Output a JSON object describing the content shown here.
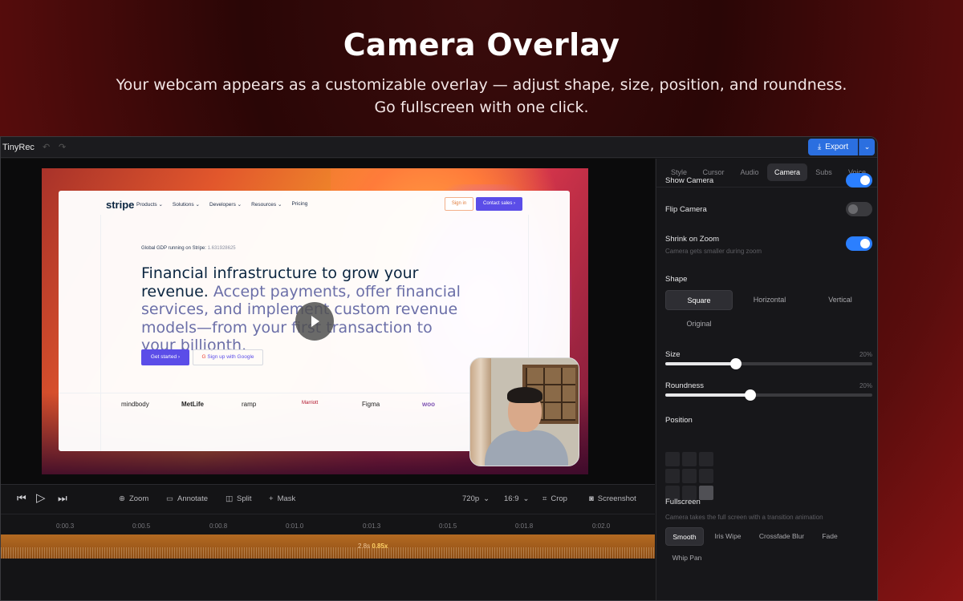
{
  "hero": {
    "title": "Camera Overlay",
    "subtitle_line1": "Your webcam appears as a customizable overlay — adjust shape, size, position, and roundness.",
    "subtitle_line2": "Go fullscreen with one click."
  },
  "app": {
    "name": "TinyRec",
    "export_label": "Export"
  },
  "website": {
    "logo": "stripe",
    "nav": [
      "Products",
      "Solutions",
      "Developers",
      "Resources",
      "Pricing"
    ],
    "signin": "Sign in",
    "contact": "Contact sales",
    "gdp_label": "Global GDP running on Stripe:",
    "gdp_value": "1.631928625",
    "headline_main": "Financial infrastructure to grow your revenue.",
    "headline_sub": "Accept payments, offer financial services, and implement custom revenue models—from your first transaction to your billionth.",
    "get_started": "Get started",
    "google_signup": "Sign up with Google",
    "logos": [
      "mindbody",
      "MetLife",
      "ramp",
      "Marriott",
      "Figma",
      "woo"
    ]
  },
  "toolbar": {
    "zoom": "Zoom",
    "annotate": "Annotate",
    "split": "Split",
    "mask": "Mask",
    "resolution": "720p",
    "aspect": "16:9",
    "crop": "Crop",
    "screenshot": "Screenshot"
  },
  "timeline": {
    "ticks": [
      "0:00.3",
      "0:00.5",
      "0:00.8",
      "0:01.0",
      "0:01.3",
      "0:01.5",
      "0:01.8",
      "0:02.0"
    ],
    "clip_duration": "2.8s",
    "clip_speed": "0.85x"
  },
  "panel": {
    "tabs": [
      "Style",
      "Cursor",
      "Audio",
      "Camera",
      "Subs",
      "Voice"
    ],
    "active_tab": "Camera",
    "show_camera": "Show Camera",
    "show_camera_on": true,
    "flip_camera": "Flip Camera",
    "flip_camera_on": false,
    "shrink_on_zoom": "Shrink on Zoom",
    "shrink_on_zoom_hint": "Camera gets smaller during zoom",
    "shrink_on_zoom_on": true,
    "shape_label": "Shape",
    "shapes": [
      "Square",
      "Horizontal",
      "Vertical",
      "Original"
    ],
    "active_shape": "Square",
    "size_label": "Size",
    "size_value": "20%",
    "size_fraction": 0.34,
    "roundness_label": "Roundness",
    "roundness_value": "20%",
    "roundness_fraction": 0.41,
    "position_label": "Position",
    "position_active": "bottom-right",
    "fullscreen_label": "Fullscreen",
    "fullscreen_hint": "Camera takes the full screen with a transition animation",
    "transitions": [
      "Smooth",
      "Iris Wipe",
      "Crossfade Blur",
      "Fade",
      "Whip Pan"
    ],
    "active_transition": "Smooth"
  },
  "colors": {
    "accent": "#2b7fff",
    "export_button": "#2b6fe0",
    "track": "#b46a22",
    "stripe_purple": "#5b4de8"
  }
}
